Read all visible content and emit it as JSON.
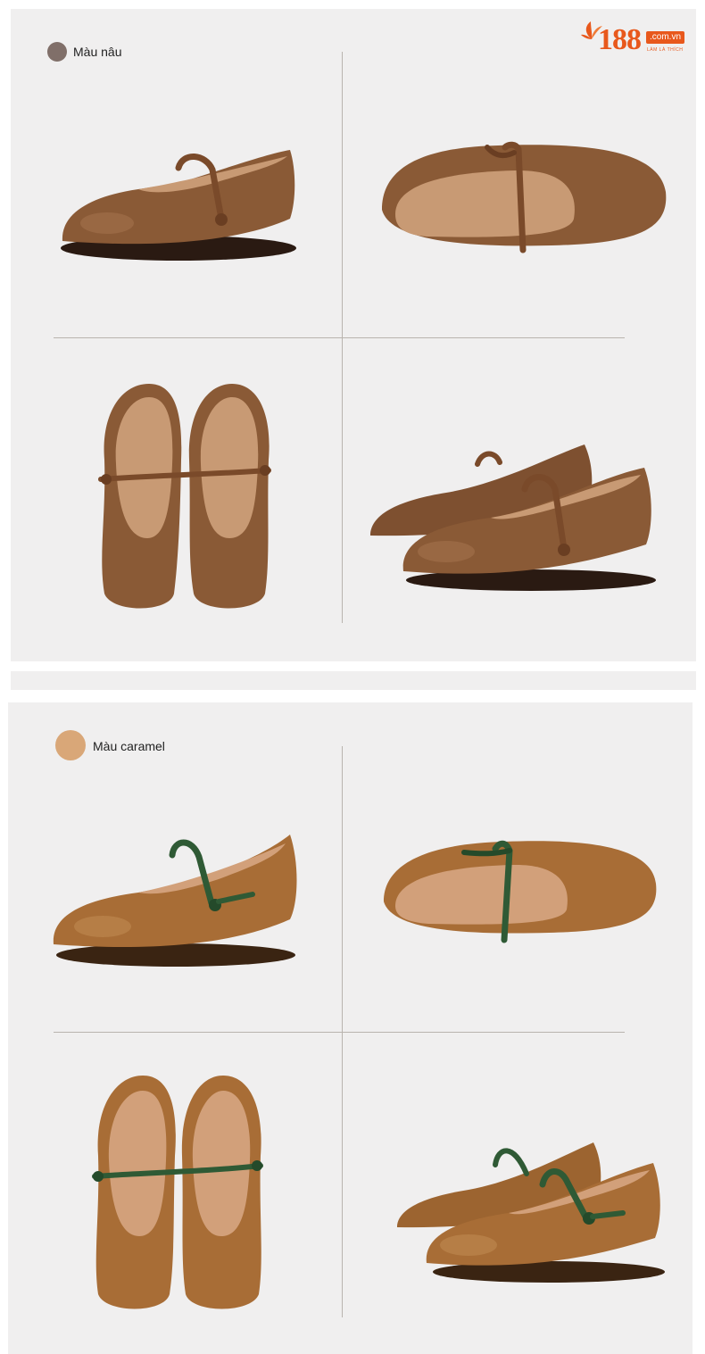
{
  "brand": {
    "logo_number": "188",
    "logo_domain": ".com.vn",
    "logo_slogan": "LÀM LÀ THÍCH",
    "accent_color": "#e8581c"
  },
  "sections": [
    {
      "color_label": "Màu nâu",
      "swatch_color": "#806f69",
      "shoe_leather": "#8a5a36",
      "strap_color": "#7a4a2a",
      "insole_color": "#c89a74",
      "views": [
        "side-view",
        "top-down-angled-view",
        "pair-top-view",
        "pair-side-view"
      ]
    },
    {
      "color_label": "Màu caramel",
      "swatch_color": "#d9a778",
      "shoe_leather": "#a86d36",
      "strap_color": "#2f5a35",
      "insole_color": "#d2a07a",
      "views": [
        "side-view",
        "top-down-angled-view",
        "pair-top-view",
        "pair-side-view"
      ]
    }
  ]
}
